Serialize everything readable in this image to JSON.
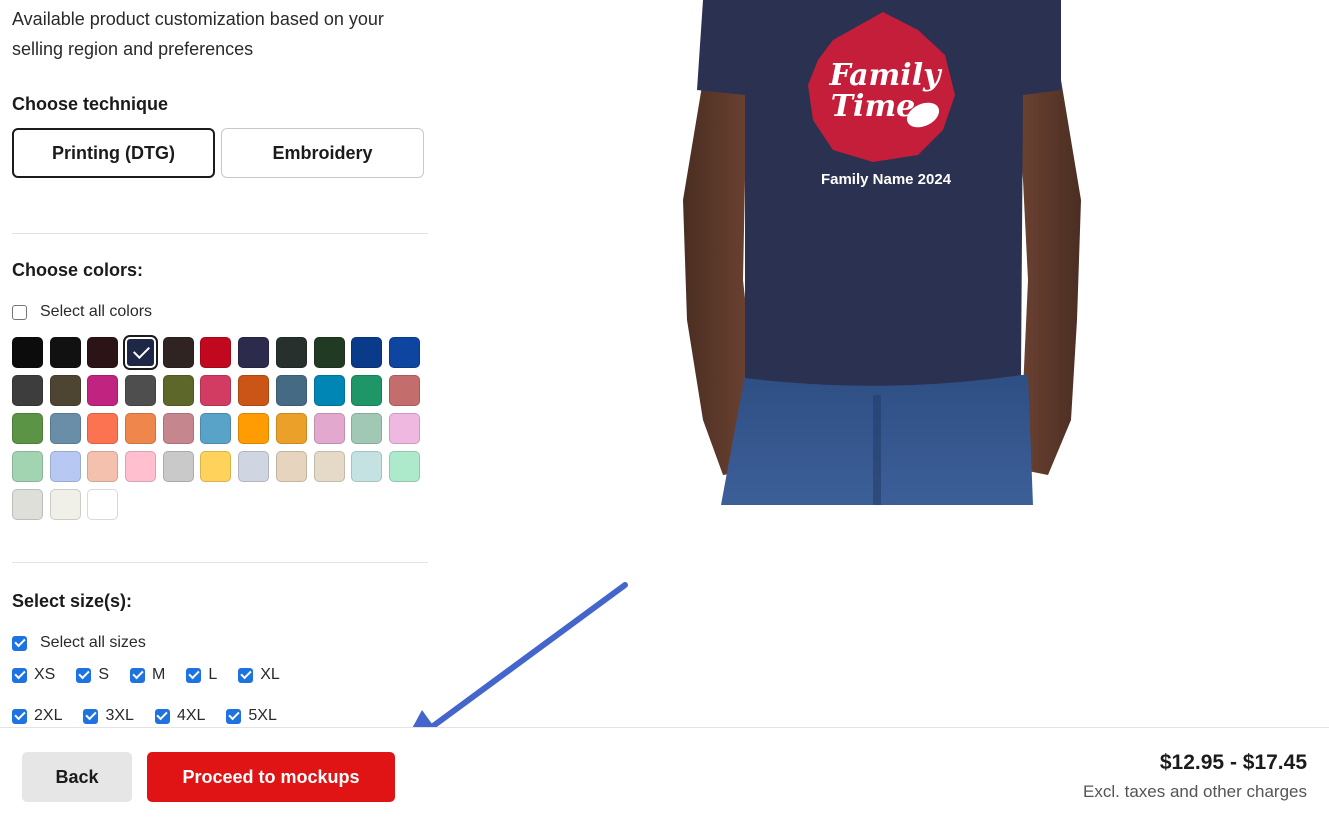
{
  "intro": {
    "line1": "Available product customization based on your",
    "line2": "selling region and preferences"
  },
  "technique": {
    "title": "Choose technique",
    "options": [
      {
        "label": "Printing (DTG)",
        "selected": true
      },
      {
        "label": "Embroidery",
        "selected": false
      }
    ]
  },
  "colors": {
    "title": "Choose colors:",
    "select_all_label": "Select all colors",
    "select_all_checked": false,
    "selected_index": 3,
    "swatches": [
      "#0c0c0c",
      "#111111",
      "#2b1316",
      "#1e2745",
      "#2f2421",
      "#c1081f",
      "#2d2b4c",
      "#27302d",
      "#213a24",
      "#0a3b8b",
      "#0e45a0",
      "#3d3d3d",
      "#4d4531",
      "#c02480",
      "#4e4e4e",
      "#5d672a",
      "#d23c62",
      "#cb5516",
      "#456b84",
      "#0086b4",
      "#1e9668",
      "#c46d6d",
      "#5a9444",
      "#6a8ea8",
      "#fb7351",
      "#ef864b",
      "#c6868e",
      "#5aa3c8",
      "#ff9c04",
      "#eba029",
      "#e3a8cd",
      "#a0c8b5",
      "#efb8e1",
      "#a3d4b2",
      "#b7c8f2",
      "#f4c1af",
      "#ffbfcf",
      "#c9c9c9",
      "#ffd25b",
      "#d0d5e2",
      "#e6d4bf",
      "#e5dac8",
      "#c5e2e2",
      "#ade9cb",
      "#dfdfda",
      "#f0f0e8",
      "#ffffff"
    ]
  },
  "sizes": {
    "title": "Select size(s):",
    "select_all_label": "Select all sizes",
    "select_all_checked": true,
    "items": [
      {
        "label": "XS",
        "checked": true
      },
      {
        "label": "S",
        "checked": true
      },
      {
        "label": "M",
        "checked": true
      },
      {
        "label": "L",
        "checked": true
      },
      {
        "label": "XL",
        "checked": true
      },
      {
        "label": "2XL",
        "checked": true
      },
      {
        "label": "3XL",
        "checked": true
      },
      {
        "label": "4XL",
        "checked": true
      },
      {
        "label": "5XL",
        "checked": true
      }
    ]
  },
  "product": {
    "design_line1": "Family",
    "design_line2": "Time",
    "design_subtitle": "Family Name 2024",
    "shirt_color": "#2b3150",
    "design_accent": "#c41e3a"
  },
  "footer": {
    "back_label": "Back",
    "proceed_label": "Proceed to mockups",
    "price": "$12.95 - $17.45",
    "price_note": "Excl. taxes and other charges"
  },
  "annotation": {
    "arrow_color": "#4466cc",
    "arrow_icon": "arrow-pointer-icon"
  }
}
